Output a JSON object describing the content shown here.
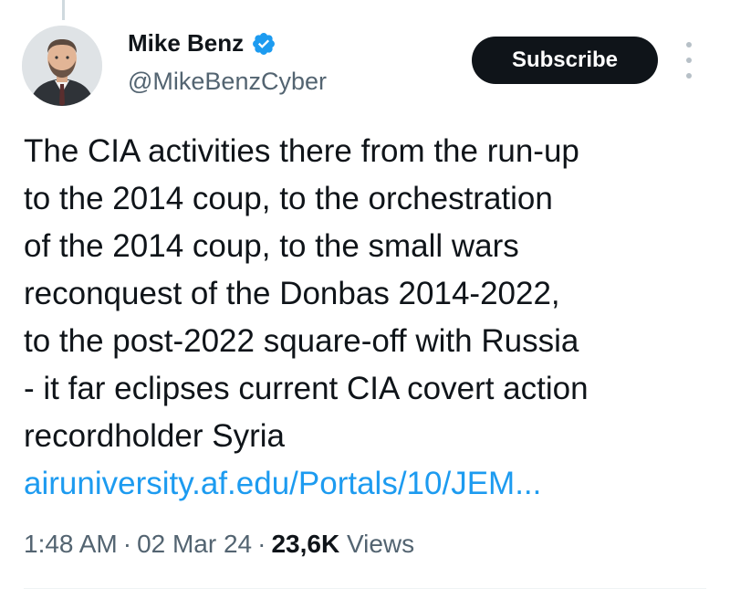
{
  "author": {
    "display_name": "Mike Benz",
    "handle": "@MikeBenzCyber",
    "verified": true,
    "verified_color": "#1d9bf0"
  },
  "actions": {
    "subscribe_label": "Subscribe",
    "more_icon": "more-vertical-icon"
  },
  "tweet": {
    "lines": [
      "The CIA activities there from the run-up",
      "to the 2014 coup, to the orchestration",
      "of the 2014 coup, to the small wars",
      "reconquest of the Donbas 2014-2022,",
      "to the post-2022 square-off with Russia",
      "- it far eclipses current CIA covert action",
      "recordholder Syria"
    ],
    "link_text": "airuniversity.af.edu/Portals/10/JEM..."
  },
  "meta": {
    "time": "1:48 AM",
    "date": "02 Mar 24",
    "views_count": "23,6K",
    "views_label": "Views",
    "separator": "·"
  }
}
